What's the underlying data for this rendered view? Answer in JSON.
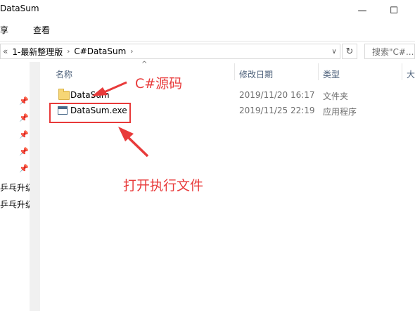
{
  "window": {
    "title": "DataSum",
    "minimize_glyph": "—",
    "maximize_glyph": "☐",
    "close_glyph": "✕"
  },
  "ribbon": {
    "share_label": "共享",
    "view_label": "查看"
  },
  "address_bar": {
    "overflow_glyph": "«",
    "segments": [
      "1-最新整理版",
      "C#DataSum"
    ],
    "separator": "›",
    "dropdown_glyph": "∨",
    "refresh_glyph": "↻"
  },
  "search": {
    "placeholder": "搜索\"C#..."
  },
  "nav_pane": {
    "pin_glyph": "📌",
    "items": [
      "乒乓升级",
      "乒乓升级"
    ]
  },
  "columns": {
    "name": "名称",
    "date_modified": "修改日期",
    "type": "类型",
    "size": "大"
  },
  "files": [
    {
      "name": "DataSum",
      "date": "2019/11/20 16:17",
      "type": "文件夹",
      "icon": "folder-icon"
    },
    {
      "name": "DataSum.exe",
      "date": "2019/11/25 22:19",
      "type": "应用程序",
      "icon": "exe-icon"
    }
  ],
  "annotations": {
    "csharp_source": "C#源码",
    "open_exe": "打开执行文件",
    "accent_color": "#e83a3a"
  }
}
